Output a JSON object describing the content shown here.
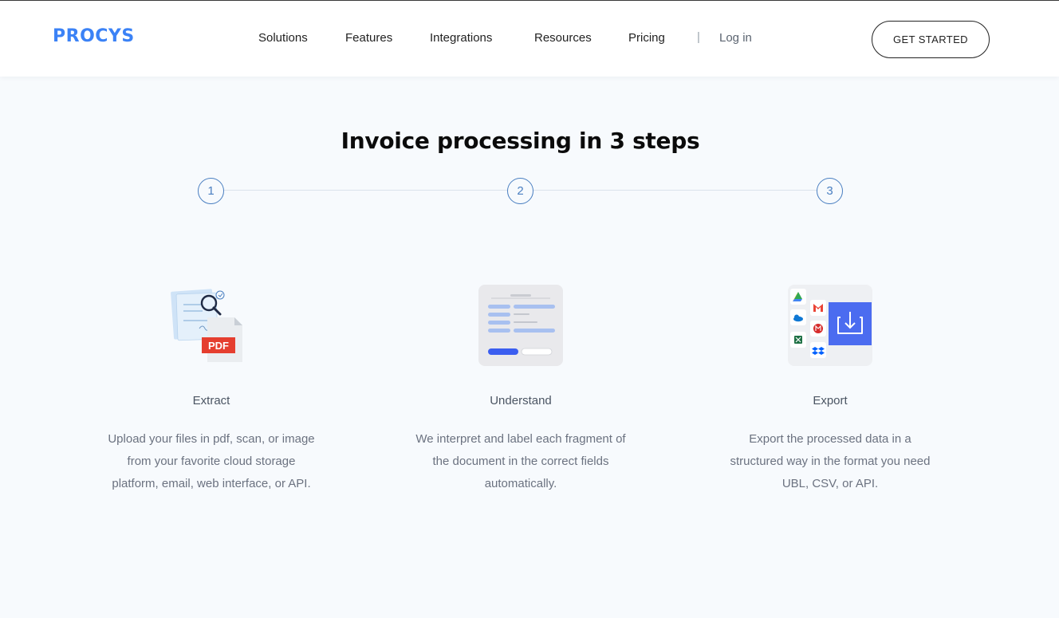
{
  "header": {
    "logo": "PROCYS",
    "nav": [
      "Solutions",
      "Features",
      "Integrations",
      "Resources",
      "Pricing"
    ],
    "separator": "|",
    "login": "Log in",
    "cta": "GET STARTED"
  },
  "main": {
    "title": "Invoice processing in 3 steps",
    "step_numbers": [
      "1",
      "2",
      "3"
    ],
    "steps": [
      {
        "title": "Extract",
        "description": "Upload your files in pdf, scan, or image from your favorite cloud storage platform, email, web interface, or API.",
        "badge": "PDF"
      },
      {
        "title": "Understand",
        "description": "We interpret and label each fragment of the document in the correct fields automatically."
      },
      {
        "title": "Export",
        "description": "Export the processed data in a structured way in the format you need UBL, CSV, or API."
      }
    ]
  },
  "colors": {
    "brand": "#3b82f6",
    "step_outline": "#4a7fc1",
    "background": "#f7fafd"
  },
  "icons": [
    "magnifier-icon",
    "pdf-file-icon",
    "form-icon",
    "google-drive-icon",
    "onedrive-icon",
    "excel-icon",
    "gmail-icon",
    "mail-icon",
    "dropbox-icon",
    "download-icon"
  ]
}
